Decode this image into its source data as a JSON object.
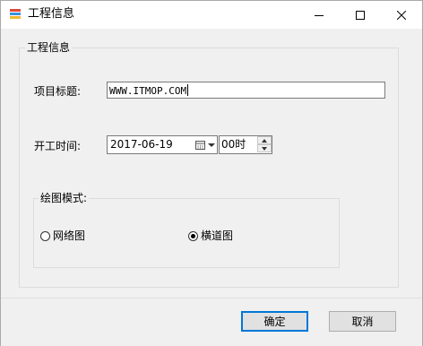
{
  "window": {
    "title": "工程信息",
    "icon": "app-stack-icon",
    "controls": [
      "minimize-icon",
      "maximize-icon",
      "close-icon"
    ]
  },
  "group": {
    "title": "工程信息"
  },
  "project_title": {
    "label": "项目标题:",
    "value": "WWW.ITMOP.COM"
  },
  "start_time": {
    "label": "开工时间:",
    "date": "2017-06-19",
    "hour": "00时"
  },
  "draw_mode": {
    "title": "绘图模式:",
    "options": [
      {
        "label": "网络图",
        "selected": false
      },
      {
        "label": "横道图",
        "selected": true
      }
    ]
  },
  "buttons": {
    "ok": "确定",
    "cancel": "取消"
  },
  "colors": {
    "focus_border": "#0078d7",
    "window_bg": "#f0f0f0",
    "titlebar_bg": "#ffffff"
  }
}
